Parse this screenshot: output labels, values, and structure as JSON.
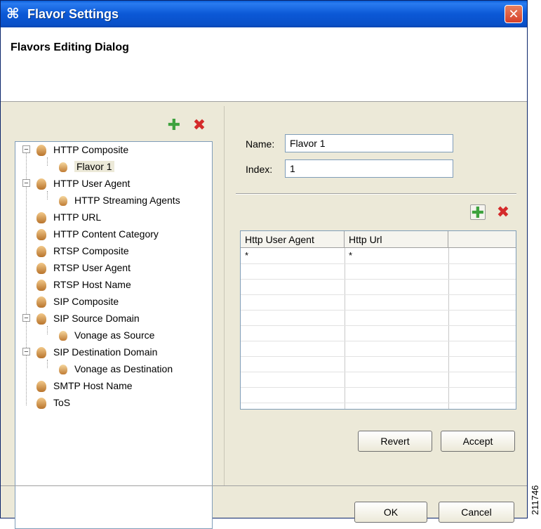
{
  "window": {
    "title": "Flavor Settings",
    "app_icon": "cisco-icon",
    "close_icon": "close-icon"
  },
  "header": {
    "title": "Flavors Editing Dialog"
  },
  "tree": {
    "add_icon": "plus-icon",
    "delete_icon": "delete-icon",
    "items": [
      {
        "label": "HTTP Composite",
        "level": 0,
        "expanded": true
      },
      {
        "label": "Flavor 1",
        "level": 1,
        "selected": true
      },
      {
        "label": "HTTP User Agent",
        "level": 0,
        "expanded": true
      },
      {
        "label": "HTTP Streaming Agents",
        "level": 1
      },
      {
        "label": "HTTP URL",
        "level": 0
      },
      {
        "label": "HTTP Content Category",
        "level": 0
      },
      {
        "label": "RTSP Composite",
        "level": 0
      },
      {
        "label": "RTSP User Agent",
        "level": 0
      },
      {
        "label": "RTSP Host Name",
        "level": 0
      },
      {
        "label": "SIP Composite",
        "level": 0
      },
      {
        "label": "SIP Source Domain",
        "level": 0,
        "expanded": true
      },
      {
        "label": "Vonage as Source",
        "level": 1
      },
      {
        "label": "SIP Destination Domain",
        "level": 0,
        "expanded": true
      },
      {
        "label": "Vonage as Destination",
        "level": 1
      },
      {
        "label": "SMTP Host Name",
        "level": 0
      },
      {
        "label": "ToS",
        "level": 0
      }
    ]
  },
  "form": {
    "name_label": "Name:",
    "name_value": "Flavor 1",
    "index_label": "Index:",
    "index_value": "1"
  },
  "table": {
    "add_icon": "plus-icon",
    "delete_icon": "delete-icon",
    "columns": [
      "Http User Agent",
      "Http Url",
      ""
    ],
    "rows": [
      [
        "*",
        "*",
        ""
      ]
    ]
  },
  "buttons": {
    "revert": "Revert",
    "accept": "Accept",
    "ok": "OK",
    "cancel": "Cancel"
  },
  "figure_number": "211746"
}
